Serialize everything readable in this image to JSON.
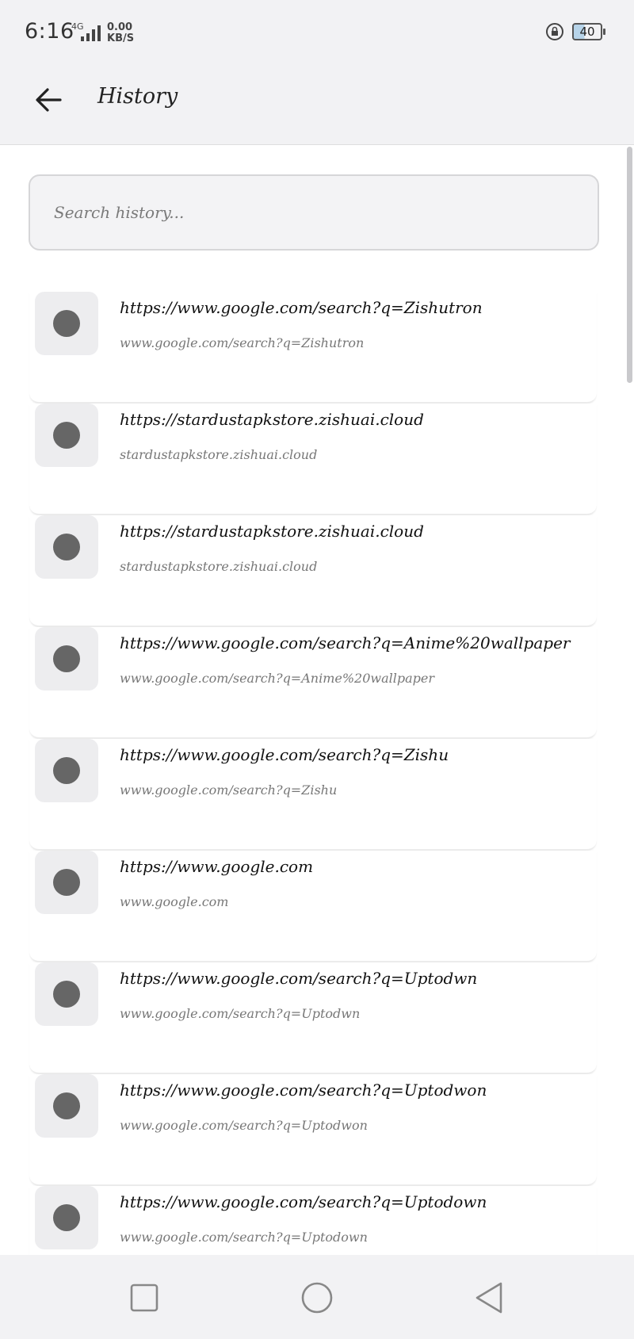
{
  "status_bar": {
    "time": "6:16",
    "network": "4G",
    "speed_value": "0.00",
    "speed_unit": "KB/S",
    "battery": "40"
  },
  "header": {
    "title": "History"
  },
  "search": {
    "placeholder": "Search history..."
  },
  "history": [
    {
      "url": "https://www.google.com/search?q=Zishutron",
      "display": "www.google.com/search?q=Zishutron"
    },
    {
      "url": "https://stardustapkstore.zishuai.cloud",
      "display": "stardustapkstore.zishuai.cloud"
    },
    {
      "url": "https://stardustapkstore.zishuai.cloud",
      "display": "stardustapkstore.zishuai.cloud"
    },
    {
      "url": "https://www.google.com/search?q=Anime%20wallpaper",
      "display": "www.google.com/search?q=Anime%20wallpaper"
    },
    {
      "url": "https://www.google.com/search?q=Zishu",
      "display": "www.google.com/search?q=Zishu"
    },
    {
      "url": "https://www.google.com",
      "display": "www.google.com"
    },
    {
      "url": "https://www.google.com/search?q=Uptodwn",
      "display": "www.google.com/search?q=Uptodwn"
    },
    {
      "url": "https://www.google.com/search?q=Uptodwon",
      "display": "www.google.com/search?q=Uptodwon"
    },
    {
      "url": "https://www.google.com/search?q=Uptodown",
      "display": "www.google.com/search?q=Uptodown"
    }
  ],
  "icons": {
    "back": "arrow-left-icon",
    "favicon": "globe-placeholder-icon",
    "nav_recent": "square-icon",
    "nav_home": "circle-icon",
    "nav_back": "triangle-icon"
  }
}
